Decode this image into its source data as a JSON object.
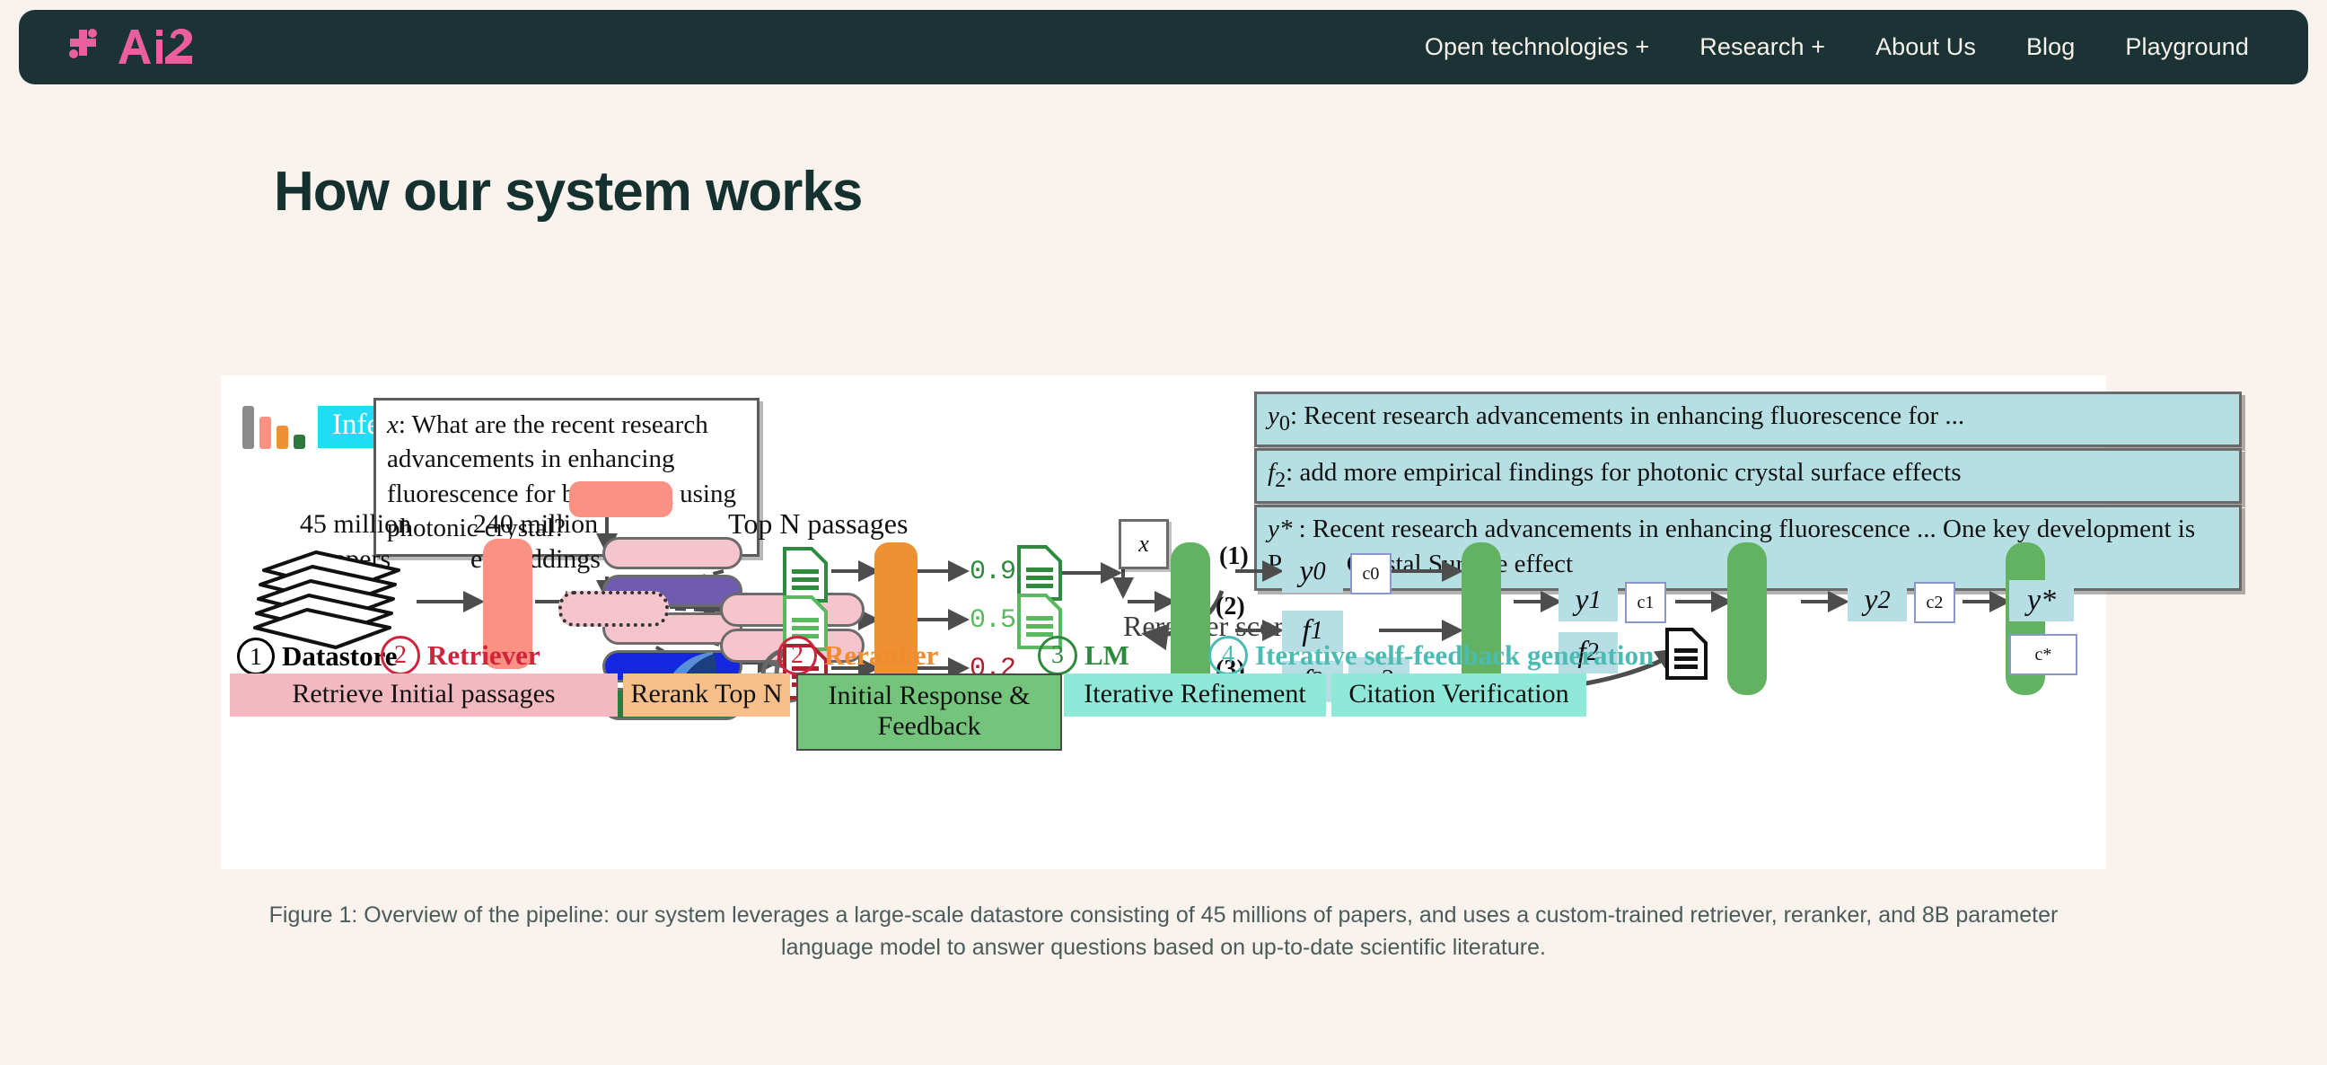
{
  "nav": {
    "brand": "Ai2",
    "brand_color": "#ec5f9e",
    "bar_color": "#1b3334",
    "links": [
      {
        "label": "Open technologies +"
      },
      {
        "label": "Research +"
      },
      {
        "label": "About Us"
      },
      {
        "label": "Blog"
      },
      {
        "label": "Playground"
      }
    ]
  },
  "heading": "How our system works",
  "figure": {
    "inference_badge": "Inference",
    "query_prefix": "x",
    "query_text": ": What are the recent research advancements in enhancing fluorescence for biosensing using photonic crystal?",
    "answers": [
      {
        "sym": "y",
        "sub": "0",
        "text": ": Recent research advancements in enhancing fluorescence for ..."
      },
      {
        "sym": "f",
        "sub": "2",
        "text": ": add more empirical findings for photonic crystal surface effects"
      },
      {
        "sym": "y*",
        "sub": "",
        "text": " : Recent research advancements in enhancing fluorescence ... One key development is Phonic Crystal Surface effect"
      }
    ],
    "labels": {
      "papers": "45 million papers",
      "embeddings": "240 million embeddings",
      "top_n": "Top N passages",
      "reranker_scores": "Reranker scores",
      "x_box": "x"
    },
    "reranker_scores": [
      "0.9",
      "0.5",
      "0.2"
    ],
    "reranker_score_colors": [
      "#2e8b3d",
      "#58b95e",
      "#b01f2e"
    ],
    "feedback_markers": [
      "(1)",
      "(2)",
      "(3)"
    ],
    "lm_chips": [
      {
        "label": "y",
        "sub": "0"
      },
      {
        "label": "f",
        "sub": "1"
      },
      {
        "label": "f",
        "sub": "2"
      },
      {
        "label": "q",
        "sub": "2"
      },
      {
        "label": "y",
        "sub": "1"
      },
      {
        "label": "f",
        "sub": "2"
      },
      {
        "label": "y",
        "sub": "2"
      },
      {
        "label": "y*",
        "sub": ""
      }
    ],
    "citation_boxes": [
      "c0",
      "c1",
      "c2",
      "c*"
    ],
    "steps": [
      {
        "num": "1",
        "label": "Datastore",
        "color": "#000000"
      },
      {
        "num": "2",
        "label": "Retriever",
        "color": "#d2233c"
      },
      {
        "num": "2",
        "label": "Reranker",
        "color": "#f08b2e"
      },
      {
        "num": "3",
        "label": "LM",
        "color": "#2e8b3d"
      },
      {
        "num": "4",
        "label": "Iterative self-feedback generation",
        "color": "#4bbcb4"
      }
    ],
    "stages": [
      {
        "label": "Retrieve Initial passages",
        "color": "#f4b8c0"
      },
      {
        "label": "Rerank Top N",
        "color": "#f7c08a"
      },
      {
        "label": "Initial Response & Feedback",
        "color": "#74c47c"
      },
      {
        "label": "Iterative Refinement",
        "color": "#8ee9d8"
      },
      {
        "label": "Citation Verification",
        "color": "#8ee9d8"
      }
    ],
    "embedding_colors": [
      "#f6c4cd",
      "#6f5bb0",
      "#f6c4cd",
      "#1426e0",
      "#2e7a3e"
    ]
  },
  "caption": "Figure 1: Overview of the pipeline: our system leverages a large-scale datastore consisting of 45 millions of papers, and uses a custom-trained retriever, reranker, and 8B parameter language model to answer questions based on up-to-date scientific literature."
}
